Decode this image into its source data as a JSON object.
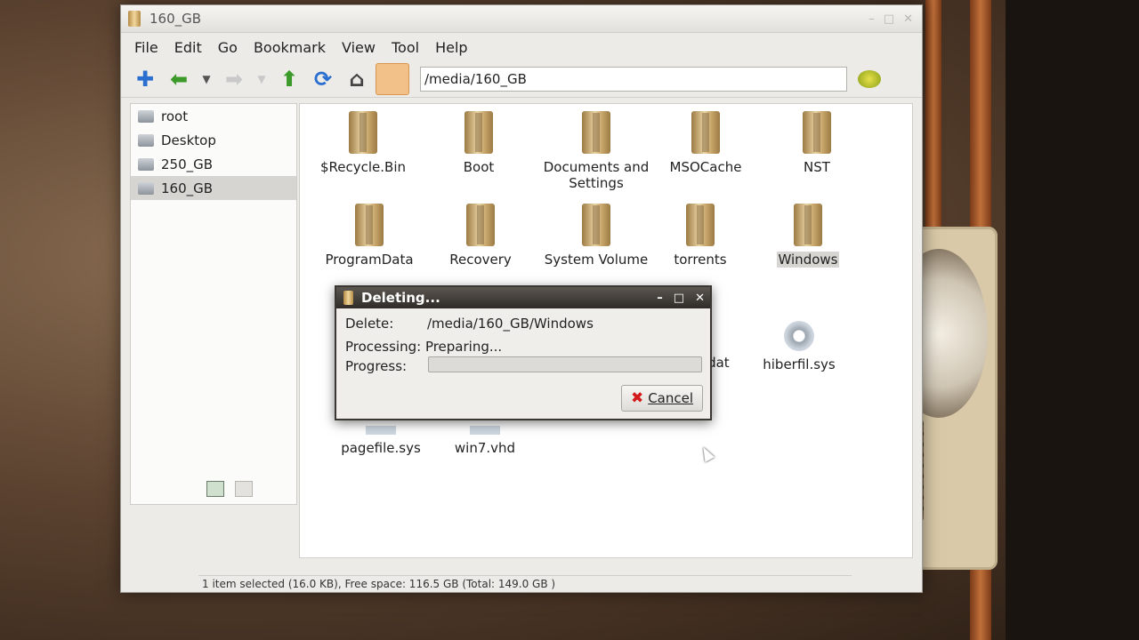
{
  "window": {
    "title": "160_GB"
  },
  "menu": [
    "File",
    "Edit",
    "Go",
    "Bookmark",
    "View",
    "Tool",
    "Help"
  ],
  "toolbar": {
    "icons": [
      "new-tab-icon",
      "back-icon",
      "history-dropdown-icon",
      "forward-icon",
      "forward-history-dropdown-icon",
      "up-icon",
      "reload-icon",
      "home-icon",
      "folder-icon",
      "go-icon"
    ],
    "address": "/media/160_GB"
  },
  "sidebar": {
    "items": [
      {
        "label": "root",
        "icon": "folder-icon"
      },
      {
        "label": "Desktop",
        "icon": "desktop-icon"
      },
      {
        "label": "250_GB",
        "icon": "drive-icon"
      },
      {
        "label": "160_GB",
        "icon": "drive-icon",
        "selected": true
      }
    ]
  },
  "files": [
    {
      "name": "$Recycle.Bin",
      "type": "folder"
    },
    {
      "name": "Boot",
      "type": "folder"
    },
    {
      "name": "Documents and Settings",
      "type": "folder"
    },
    {
      "name": "MSOCache",
      "type": "folder"
    },
    {
      "name": "NST",
      "type": "folder"
    },
    {
      "name": "ProgramData",
      "type": "folder"
    },
    {
      "name": "Recovery",
      "type": "folder"
    },
    {
      "name": "System Volume",
      "type": "folder"
    },
    {
      "name": "torrents",
      "type": "folder"
    },
    {
      "name": "Windows",
      "type": "folder",
      "selected": true
    },
    {
      "name": ".dat",
      "type": "file"
    },
    {
      "name": "hiberfil.sys",
      "type": "file"
    },
    {
      "name": "pagefile.sys",
      "type": "file"
    },
    {
      "name": "win7.vhd",
      "type": "file"
    }
  ],
  "status": "1 item selected (16.0 KB), Free space: 116.5 GB (Total: 149.0 GB )",
  "dialog": {
    "title": "Deleting...",
    "delete_label": "Delete:",
    "delete_value": "/media/160_GB/Windows",
    "processing_label": "Processing:",
    "processing_value": "Preparing...",
    "progress_label": "Progress:",
    "progress": 0,
    "cancel_label": "Cancel"
  },
  "colors": {
    "selection": "#d6d5d2",
    "dialog_title": "#2f2b27",
    "cancel_icon": "#d21a1a"
  }
}
